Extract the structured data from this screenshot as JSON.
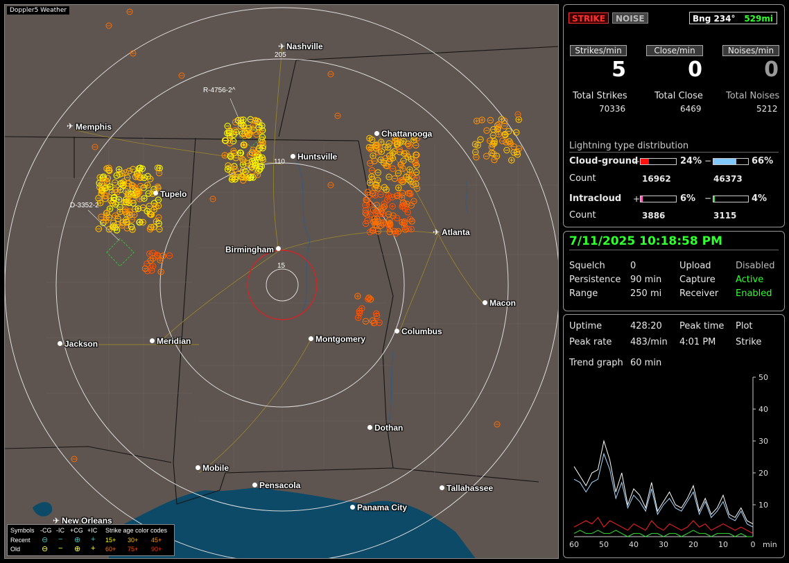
{
  "map": {
    "title": "Doppler5 Weather",
    "cities": [
      {
        "name": "Nashville",
        "kind": "plane"
      },
      {
        "name": "Memphis",
        "kind": "plane"
      },
      {
        "name": "Huntsville",
        "kind": "dot"
      },
      {
        "name": "Chattanooga",
        "kind": "dot"
      },
      {
        "name": "Tupelo",
        "kind": "dot"
      },
      {
        "name": "Birmingham",
        "kind": "dot"
      },
      {
        "name": "Atlanta",
        "kind": "plane"
      },
      {
        "name": "Macon",
        "kind": "dot"
      },
      {
        "name": "Columbus",
        "kind": "dot"
      },
      {
        "name": "Montgomery",
        "kind": "dot"
      },
      {
        "name": "Jackson",
        "kind": "dot"
      },
      {
        "name": "Meridian",
        "kind": "dot"
      },
      {
        "name": "Dothan",
        "kind": "dot"
      },
      {
        "name": "Mobile",
        "kind": "dot"
      },
      {
        "name": "Pensacola",
        "kind": "dot"
      },
      {
        "name": "Tallahassee",
        "kind": "dot"
      },
      {
        "name": "Panama City",
        "kind": "dot"
      },
      {
        "name": "New Orleans",
        "kind": "plane"
      }
    ],
    "range_labels": [
      "205",
      "110",
      "15"
    ],
    "restricted_areas": [
      "R-4756-2^",
      "D-3352-2"
    ],
    "legend": {
      "row_header": [
        "Symbols",
        "-CG",
        "-IC",
        "+CG",
        "+IC",
        "Strike age color codes"
      ],
      "recent_label": "Recent",
      "old_label": "Old",
      "recent_ages": [
        "15+",
        "30+",
        "45+"
      ],
      "old_ages": [
        "60+",
        "75+",
        "90+"
      ],
      "age_colors": [
        "#ffff00",
        "#ffc000",
        "#ff9000",
        "#ff7000",
        "#ff5000",
        "#ff3000"
      ]
    }
  },
  "stats": {
    "strike_btn": "STRIKE",
    "noise_btn": "NOISE",
    "bearing": "Bng 234°",
    "distance": "529mi",
    "headers": [
      "Strikes/min",
      "Close/min",
      "Noises/min"
    ],
    "rates": [
      "5",
      "0",
      "0"
    ],
    "totals_labels": [
      "Total Strikes",
      "Total Close",
      "Total Noises"
    ],
    "totals_values": [
      "70336",
      "6469",
      "5212"
    ],
    "dist_title": "Lightning type distribution",
    "cg_label": "Cloud-ground",
    "cg_pos_sign": "+",
    "cg_pos_pct": "24%",
    "cg_pos_fill": 0.24,
    "cg_neg_sign": "−",
    "cg_neg_pct": "66%",
    "cg_neg_fill": 0.66,
    "count_label": "Count",
    "cg_pos_count": "16962",
    "cg_neg_count": "46373",
    "ic_label": "Intracloud",
    "ic_pos_pct": "6%",
    "ic_pos_fill": 0.06,
    "ic_neg_pct": "4%",
    "ic_neg_fill": 0.04,
    "ic_pos_count": "3886",
    "ic_neg_count": "3115",
    "bar_colors": {
      "cg_pos": "#ff1010",
      "cg_neg": "#80c8ff",
      "ic_pos": "#ff60c0",
      "ic_neg": "#30e030"
    }
  },
  "status": {
    "datetime": "7/11/2025 10:18:58 PM",
    "rows": [
      {
        "label": "Squelch",
        "value": "0",
        "label2": "Upload",
        "value2": "Disabled",
        "active": false
      },
      {
        "label": "Persistence",
        "value": "90 min",
        "label2": "Capture",
        "value2": "Active",
        "active": true
      },
      {
        "label": "Range",
        "value": "250 mi",
        "label2": "Receiver",
        "value2": "Enabled",
        "active": true
      }
    ]
  },
  "trend": {
    "uptime_label": "Uptime",
    "uptime": "428:20",
    "peak_time_label": "Peak time",
    "plot_label": "Plot",
    "peak_rate_label": "Peak rate",
    "peak_rate": "483/min",
    "peak_time": "4:01 PM",
    "plot": "Strike",
    "trend_graph_label": "Trend graph",
    "trend_graph": "60 min",
    "y_ticks": [
      "50",
      "40",
      "30",
      "20",
      "10"
    ],
    "x_ticks": [
      "60",
      "50",
      "40",
      "30",
      "20",
      "10",
      "0"
    ],
    "x_unit": "min"
  },
  "chart_data": {
    "type": "line",
    "title": "",
    "xlabel": "min",
    "ylabel": "",
    "xlim": [
      60,
      0
    ],
    "ylim": [
      0,
      50
    ],
    "x": [
      60,
      58,
      56,
      54,
      52,
      50,
      48,
      46,
      44,
      42,
      40,
      38,
      36,
      34,
      32,
      30,
      28,
      26,
      24,
      22,
      20,
      18,
      16,
      14,
      12,
      10,
      8,
      6,
      4,
      2,
      0
    ],
    "series": [
      {
        "color": "#ffffff",
        "values": [
          22,
          19,
          16,
          20,
          21,
          30,
          24,
          14,
          20,
          10,
          15,
          13,
          9,
          17,
          8,
          11,
          14,
          10,
          9,
          12,
          16,
          8,
          12,
          7,
          9,
          13,
          7,
          6,
          9,
          5,
          4
        ]
      },
      {
        "color": "#a8d8ff",
        "values": [
          18,
          17,
          14,
          17,
          18,
          26,
          21,
          12,
          17,
          9,
          13,
          11,
          8,
          15,
          7,
          10,
          12,
          9,
          8,
          11,
          14,
          7,
          11,
          6,
          8,
          11,
          6,
          5,
          8,
          4,
          3
        ]
      },
      {
        "color": "#ff2020",
        "values": [
          3,
          4,
          5,
          4,
          6,
          3,
          5,
          4,
          3,
          2,
          4,
          3,
          2,
          5,
          3,
          2,
          4,
          3,
          2,
          3,
          5,
          3,
          4,
          2,
          3,
          4,
          3,
          2,
          3,
          2,
          1
        ]
      },
      {
        "color": "#30e030",
        "values": [
          1,
          2,
          1,
          1,
          2,
          1,
          1,
          2,
          1,
          0,
          1,
          1,
          0,
          1,
          1,
          0,
          1,
          1,
          0,
          1,
          2,
          1,
          1,
          0,
          1,
          1,
          1,
          0,
          1,
          0,
          0
        ]
      }
    ]
  }
}
